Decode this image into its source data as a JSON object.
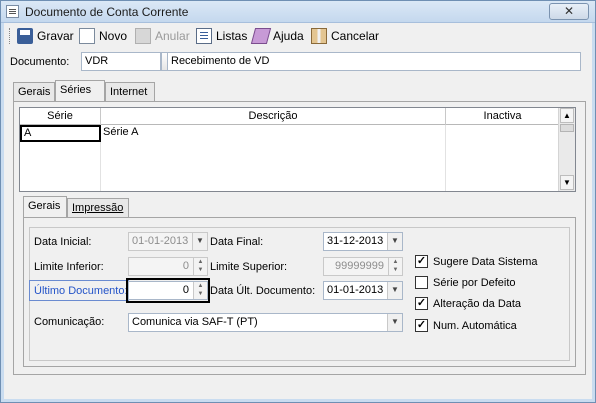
{
  "window": {
    "title": "Documento de Conta Corrente",
    "close_label": "✕"
  },
  "toolbar": {
    "save_label": "Gravar",
    "new_label": "Novo",
    "cancel_doc_label": "Anular",
    "lists_label": "Listas",
    "help_label": "Ajuda",
    "cancel_label": "Cancelar"
  },
  "document": {
    "label": "Documento:",
    "code": "VDR",
    "description": "Recebimento de VD"
  },
  "tabs": {
    "general": "Gerais",
    "series": "Séries",
    "internet": "Internet"
  },
  "grid": {
    "headers": [
      "Série",
      "Descrição",
      "Inactiva"
    ],
    "rows": [
      {
        "serie": "A",
        "descricao": "Série A",
        "inactiva": ""
      }
    ]
  },
  "subtabs": {
    "general": "Gerais",
    "print": "Impressão"
  },
  "form": {
    "start_date_label": "Data Inicial:",
    "start_date": "01-01-2013",
    "end_date_label": "Data Final:",
    "end_date": "31-12-2013",
    "lower_limit_label": "Limite Inferior:",
    "lower_limit": "0",
    "upper_limit_label": "Limite Superior:",
    "upper_limit": "99999999",
    "last_doc_label": "Último Documento:",
    "last_doc": "0",
    "last_doc_date_label": "Data Últ. Documento:",
    "last_doc_date": "01-01-2013",
    "communication_label": "Comunicação:",
    "communication": "Comunica via SAF-T (PT)"
  },
  "checks": {
    "system_date": {
      "label": "Sugere Data Sistema",
      "checked": true
    },
    "default_series": {
      "label": "Série por Defeito",
      "checked": false
    },
    "date_change": {
      "label": "Alteração da Data",
      "checked": true
    },
    "auto_number": {
      "label": "Num. Automática",
      "checked": true
    }
  }
}
